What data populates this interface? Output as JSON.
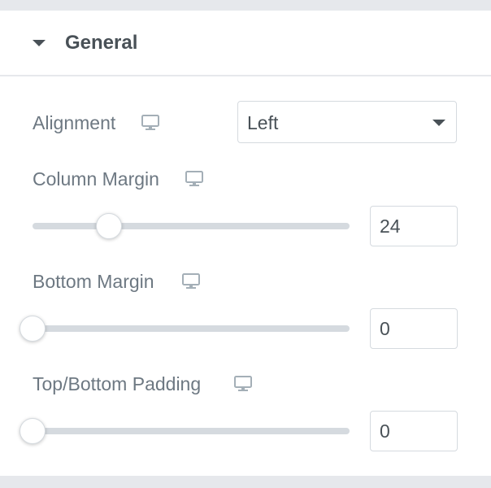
{
  "section": {
    "title": "General",
    "toggle_icon": "caret-down-icon"
  },
  "controls": {
    "alignment": {
      "label": "Alignment",
      "device_icon": "desktop-monitor-icon",
      "selected": "Left"
    },
    "column_margin": {
      "label": "Column Margin",
      "device_icon": "desktop-monitor-icon",
      "value": "24",
      "slider_fraction": 0.24
    },
    "bottom_margin": {
      "label": "Bottom Margin",
      "device_icon": "desktop-monitor-icon",
      "value": "0",
      "slider_fraction": 0
    },
    "top_bottom_padding": {
      "label": "Top/Bottom Padding",
      "device_icon": "desktop-monitor-icon",
      "value": "0",
      "slider_fraction": 0
    }
  },
  "colors": {
    "heading": "#495157",
    "label": "#6d7882",
    "border": "#d5dadf",
    "track": "#d5dadf",
    "background_band": "#e6e8ec"
  }
}
